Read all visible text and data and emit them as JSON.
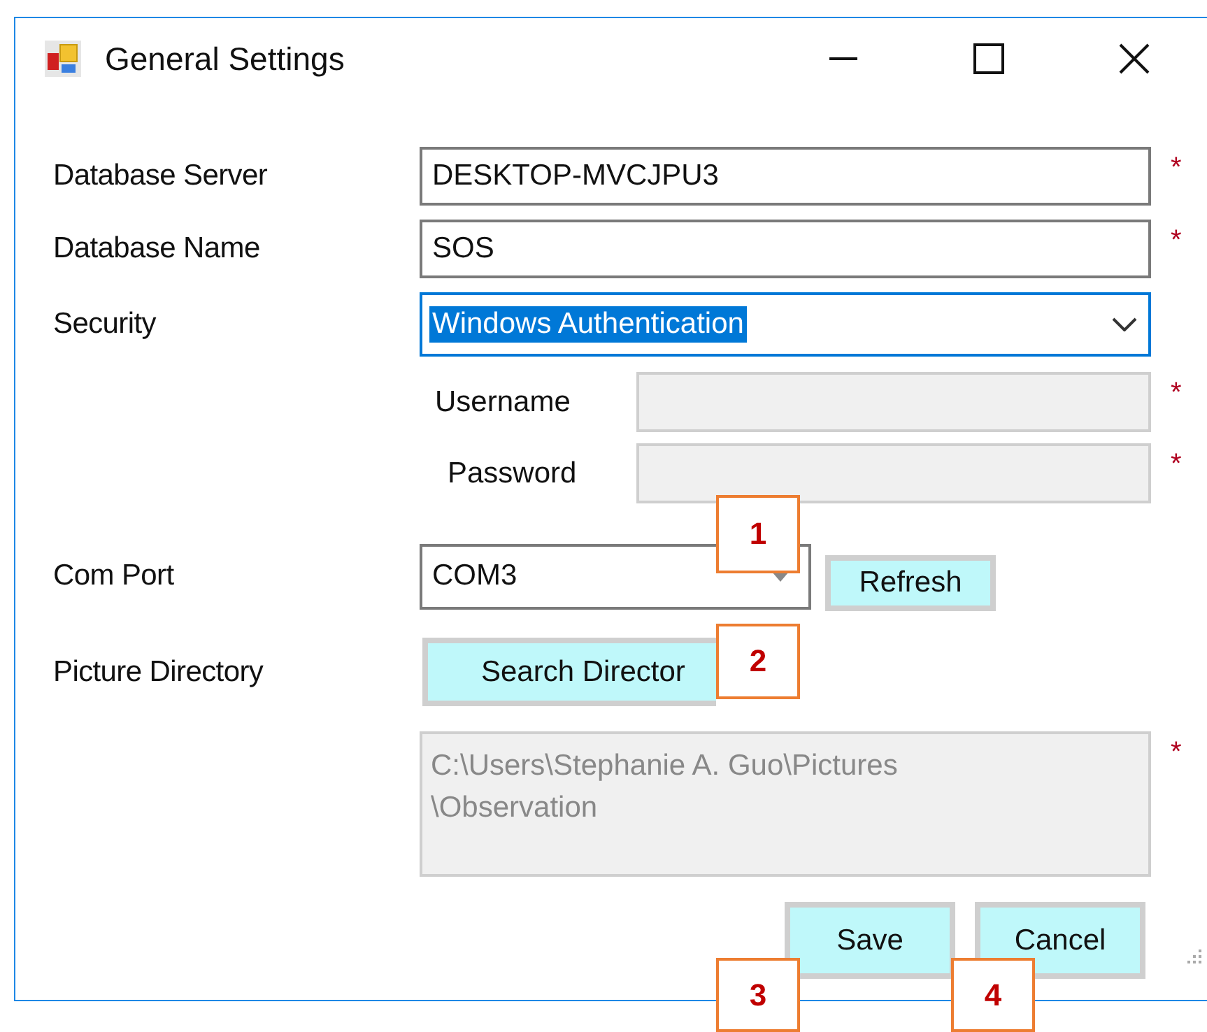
{
  "window": {
    "title": "General Settings"
  },
  "database_server": {
    "label": "Database Server",
    "value": "DESKTOP-MVCJPU3",
    "required_mark": "*"
  },
  "database_name": {
    "label": "Database Name",
    "value": "SOS",
    "required_mark": "*"
  },
  "security": {
    "label": "Security",
    "value": "Windows Authentication",
    "highlighted": true
  },
  "credentials": [
    {
      "label": "Username",
      "disabled": true,
      "required_mark": "*"
    },
    {
      "label": "Password",
      "disabled": true,
      "required_mark": "*"
    }
  ],
  "com_port": {
    "label": "Com Port",
    "value": "COM3",
    "button": "Refresh"
  },
  "picture_directory": {
    "label": "Picture Directory",
    "button": "Search Director",
    "path": "C:\\Users\\Stephanie A. Guo\\Pictures\n\\Observation",
    "path_disabled": true,
    "required_mark": "*"
  },
  "buttons": [
    "Save",
    "Cancel"
  ],
  "callouts": [
    "1",
    "2",
    "3",
    "4"
  ]
}
